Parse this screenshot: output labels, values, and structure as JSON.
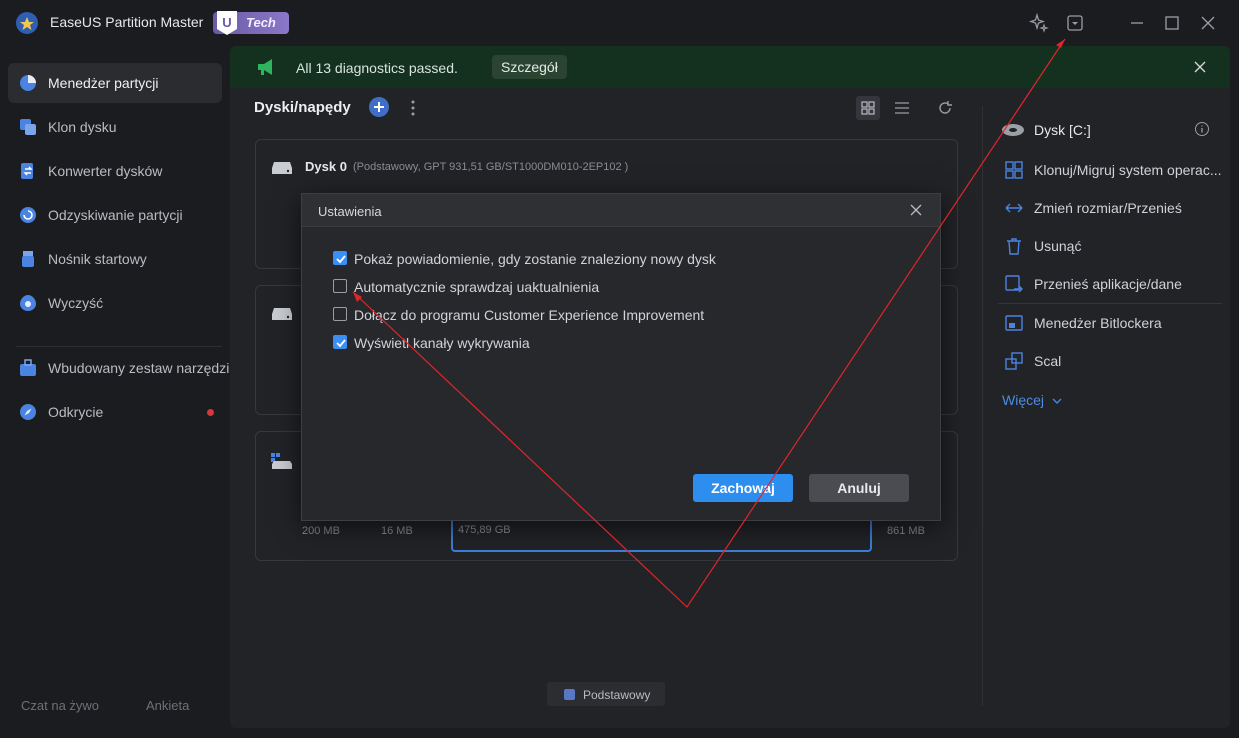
{
  "app": {
    "title": "EaseUS Partition Master",
    "badge_u": "U",
    "badge_label": "Tech"
  },
  "sidebar": {
    "items": [
      {
        "label": "Menedżer partycji",
        "icon": "pie-chart-icon",
        "active": true
      },
      {
        "label": "Klon dysku",
        "icon": "clone-icon"
      },
      {
        "label": "Konwerter dysków",
        "icon": "convert-icon"
      },
      {
        "label": "Odzyskiwanie partycji",
        "icon": "recover-icon"
      },
      {
        "label": "Nośnik startowy",
        "icon": "usb-icon"
      },
      {
        "label": "Wyczyść",
        "icon": "clean-icon"
      },
      {
        "label": "Wbudowany zestaw narzędzi",
        "icon": "toolkit-icon"
      },
      {
        "label": "Odkrycie",
        "icon": "compass-icon"
      }
    ],
    "footer": {
      "chat": "Czat na żywo",
      "survey": "Ankieta"
    }
  },
  "banner": {
    "text": "All 13 diagnostics passed.",
    "button": "Szczegół"
  },
  "main": {
    "title": "Dyski/napędy",
    "disk0": {
      "name": "Dysk 0",
      "info": "(Podstawowy, GPT 931,51 GB/ST1000DM010-2EP102 )"
    },
    "disk2_parts": [
      "200 MB",
      "16 MB",
      "475,89 GB",
      "861 MB"
    ],
    "legend": "Podstawowy"
  },
  "right_panel": {
    "title": "Dysk [C:]",
    "actions": [
      {
        "label": "Klonuj/Migruj system operac...",
        "icon": "windows-icon"
      },
      {
        "label": "Zmień rozmiar/Przenieś",
        "icon": "resize-icon"
      },
      {
        "label": "Usunąć",
        "icon": "trash-icon"
      },
      {
        "label": "Przenieś aplikacje/dane",
        "icon": "migrate-icon"
      },
      {
        "label": "Menedżer Bitlockera",
        "icon": "bitlocker-icon"
      },
      {
        "label": "Scal",
        "icon": "merge-icon"
      }
    ],
    "more": "Więcej"
  },
  "dialog": {
    "title": "Ustawienia",
    "options": [
      {
        "label": "Pokaż powiadomienie, gdy zostanie znaleziony nowy dysk",
        "checked": true
      },
      {
        "label": "Automatycznie sprawdzaj uaktualnienia",
        "checked": false
      },
      {
        "label": "Dołącz do programu Customer Experience Improvement",
        "checked": false
      },
      {
        "label": "Wyświetl kanały wykrywania",
        "checked": true
      }
    ],
    "save": "Zachowaj",
    "cancel": "Anuluj"
  },
  "colors": {
    "accent": "#2e8ef0",
    "banner_bg": "#14301f",
    "annotation": "#e0252a"
  }
}
